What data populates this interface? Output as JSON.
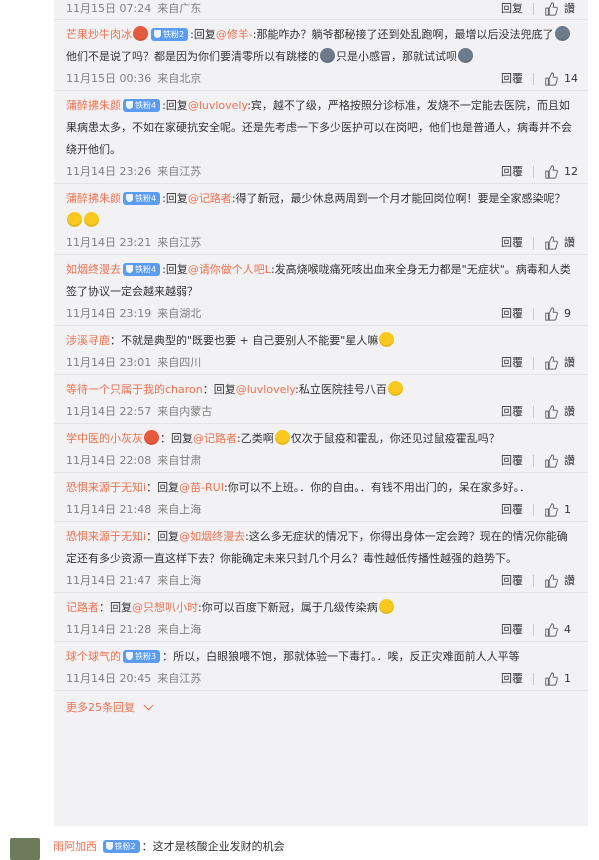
{
  "comments": [
    {
      "time": "11月15日 07:24",
      "loc": "来自广东",
      "reply_label": "回复",
      "like_label": "讚",
      "count": ""
    },
    {
      "user": "芒果炒牛肉冰",
      "badge": "铁粉2",
      "reply_word": "回复",
      "mention": "@修羊-",
      "text": ":那能咋办？躺爷都秘接了还到处乱跑啊，最增以后没法兜底了",
      "text2": "他们不是说了吗？都是因为你们要清零所以有跳楼的",
      "text3": "只是小感冒，那就试试呗",
      "time": "11月15日 00:36",
      "loc": "来自北京",
      "reply_label": "回覆",
      "count": "14"
    },
    {
      "user": "蒲醉拂朱颜",
      "badge": "铁粉4",
      "reply_word": "回复",
      "mention": "@luvlovely",
      "text": ":宾，越不了级，严格按照分诊标准，发烧不一定能去医院，而且如果病患太多，不如在家硬抗安全呢。还是先考虑一下多少医护可以在岗吧，他们也是普通人，病毒并不会绕开他们。",
      "time": "11月14日 23:26",
      "loc": "来自江苏",
      "reply_label": "回覆",
      "count": "12"
    },
    {
      "user": "蒲醉拂朱颜",
      "badge": "铁粉4",
      "reply_word": "回复",
      "mention": "@记路者",
      "text": ":得了新冠，最少休息两周到一个月才能回岗位啊！要是全家感染呢？",
      "time": "11月14日 23:21",
      "loc": "来自江苏",
      "reply_label": "回覆",
      "like_label": "讚",
      "count": ""
    },
    {
      "user": "如烟终漫去",
      "badge": "铁粉4",
      "reply_word": "回复",
      "mention": "@请你做个人吧L",
      "text": ":发高烧喉咙痛死咳出血来全身无力都是\"无症状\"。病毒和人类签了协议一定会越来越弱？",
      "time": "11月14日 23:19",
      "loc": "来自湖北",
      "reply_label": "回覆",
      "count": "9"
    },
    {
      "user": "涉溪寻鹿",
      "text": "：不就是典型的\"既要也要 + 自己要别人不能要\"星人嘛",
      "time": "11月14日 23:01",
      "loc": "来自四川",
      "reply_label": "回覆",
      "like_label": "讚",
      "count": ""
    },
    {
      "user": "等待一个只属于我的charon",
      "reply_word": "回复",
      "mention": "@luvlovely",
      "text": ":私立医院挂号八百",
      "time": "11月14日 22:57",
      "loc": "来自内蒙古",
      "reply_label": "回覆",
      "like_label": "讚",
      "count": ""
    },
    {
      "user": "学中医的小灰灰",
      "reply_word": "回复",
      "mention": "@记路者",
      "text": ":乙类啊",
      "text2": "仅次于鼠疫和霍乱，你还见过鼠疫霍乱吗？",
      "time": "11月14日 22:08",
      "loc": "来自甘肃",
      "reply_label": "回覆",
      "like_label": "讚",
      "count": ""
    },
    {
      "user": "恐惧来源于无知i",
      "reply_word": "回复",
      "mention": "@苗-RUI",
      "text": ":你可以不上班。．你的自由。．有钱不用出门的，呆在家多好。．",
      "time": "11月14日 21:48",
      "loc": "来自上海",
      "reply_label": "回覆",
      "count": "1"
    },
    {
      "user": "恐惧来源于无知i",
      "reply_word": "回复",
      "mention": "@如烟终漫去",
      "text": ":这么多无症状的情况下，你得出身体一定会跨？现在的情况你能确定还有多少资源一直这样下去？你能确定未来只封几个月么？毒性越低传播性越强的趋势下。",
      "time": "11月14日 21:47",
      "loc": "来自上海",
      "reply_label": "回覆",
      "like_label": "讚",
      "count": ""
    },
    {
      "user": "记路者",
      "reply_word": "回复",
      "mention": "@只想叭小时",
      "text": ":你可以百度下新冠，属于几级传染病",
      "time": "11月14日 21:28",
      "loc": "来自上海",
      "reply_label": "回覆",
      "count": "4"
    },
    {
      "user": "球个球气的",
      "badge": "铁粉3",
      "text": "：所以，白眼狼喂不饱，那就体验一下毒打。．唉，反正灾难面前人人平等",
      "time": "11月14日 20:45",
      "loc": "来自江苏",
      "reply_label": "回覆",
      "count": "1"
    }
  ],
  "more_replies": "更多25条回复",
  "bottom": {
    "user": "雨阿加西",
    "badge": "铁粉2",
    "text": "：这才是核酸企业发财的机会"
  },
  "colors": {
    "accent": "#eb7350",
    "badge": "#5b9cf0",
    "panel": "#f2f2f5"
  }
}
